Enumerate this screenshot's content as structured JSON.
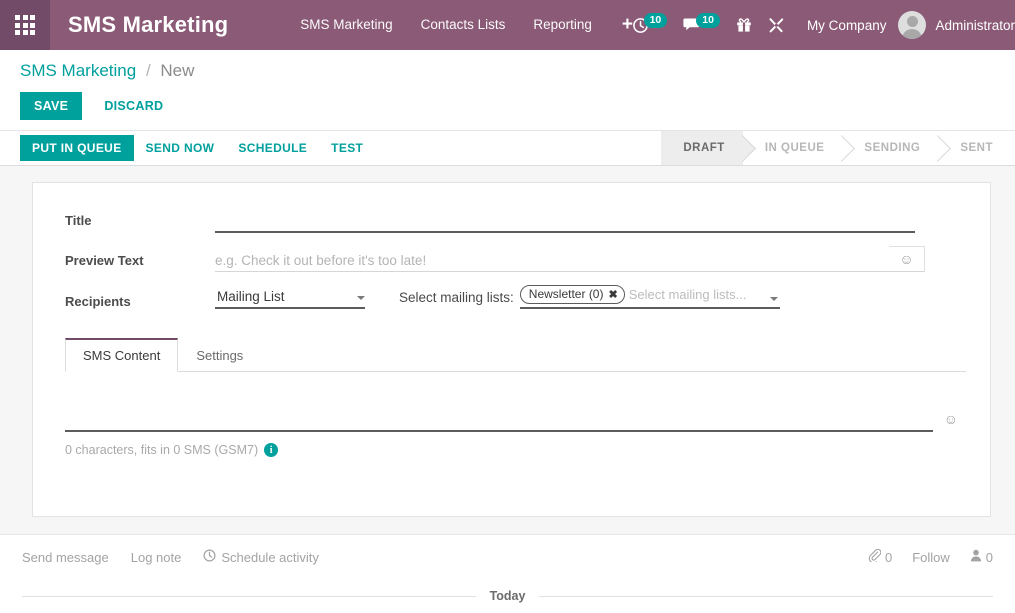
{
  "navbar": {
    "apps_icon": "apps-grid-icon",
    "brand": "SMS Marketing",
    "menus": [
      {
        "label": "SMS Marketing"
      },
      {
        "label": "Contacts Lists"
      },
      {
        "label": "Reporting"
      }
    ],
    "add_label": "+",
    "systray": [
      {
        "icon": "activity-clock-icon",
        "badge": "10"
      },
      {
        "icon": "messages-chat-icon",
        "badge": "10"
      },
      {
        "icon": "gift-icon",
        "badge": ""
      },
      {
        "icon": "tools-wrench-icon",
        "badge": ""
      }
    ],
    "company": "My Company",
    "user": "Administrator"
  },
  "breadcrumb": {
    "root": "SMS Marketing",
    "separator": "/",
    "current": "New"
  },
  "actions": {
    "save": "SAVE",
    "discard": "DISCARD"
  },
  "statusbar": {
    "buttons": [
      {
        "label": "PUT IN QUEUE",
        "primary": true
      },
      {
        "label": "SEND NOW",
        "primary": false
      },
      {
        "label": "SCHEDULE",
        "primary": false
      },
      {
        "label": "TEST",
        "primary": false
      }
    ],
    "stages": [
      {
        "label": "DRAFT",
        "active": true
      },
      {
        "label": "IN QUEUE",
        "active": false
      },
      {
        "label": "SENDING",
        "active": false
      },
      {
        "label": "SENT",
        "active": false
      }
    ]
  },
  "form": {
    "title_label": "Title",
    "title_value": "",
    "preview_label": "Preview Text",
    "preview_value": "",
    "preview_placeholder": "e.g. Check it out before it's too late!",
    "recipients_label": "Recipients",
    "recipients_value": "Mailing List",
    "recipients_options": [
      "Mailing List"
    ],
    "mailing_lists_label": "Select mailing lists:",
    "mailing_list_tags": [
      {
        "label": "Newsletter (0)",
        "remove": "✖"
      }
    ],
    "mailing_lists_placeholder": "Select mailing lists..."
  },
  "notebook": {
    "tabs": [
      {
        "label": "SMS Content",
        "active": true
      },
      {
        "label": "Settings",
        "active": false
      }
    ],
    "sms_body": "",
    "sms_placeholder": "",
    "emoji_icon": "☺",
    "char_count": "0 characters, fits in 0 SMS (GSM7)",
    "info_icon": "i"
  },
  "chatter": {
    "send_message": "Send message",
    "log_note": "Log note",
    "schedule_activity": "Schedule activity",
    "attachment_count": "0",
    "follow": "Follow",
    "follower_count": "0",
    "today": "Today"
  },
  "colors": {
    "brand_purple": "#8a5a76",
    "apps_purple": "#714b67",
    "accent_teal": "#00a09d",
    "page_bg": "#f6f6f6",
    "muted_text": "#a3a3a3"
  }
}
